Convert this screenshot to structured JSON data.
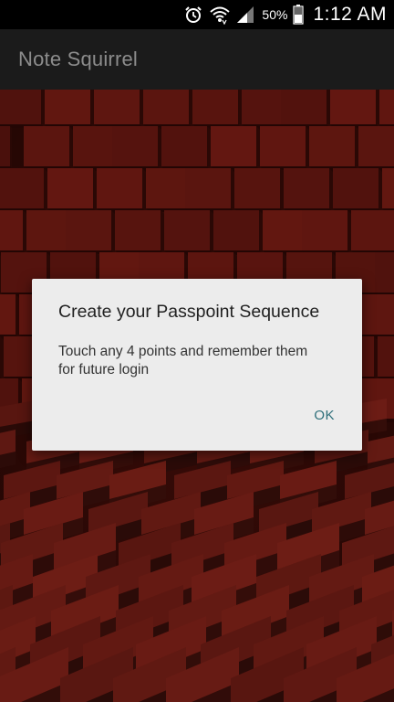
{
  "status_bar": {
    "icons": [
      "alarm-clock-icon",
      "wifi-icon",
      "cell-signal-icon",
      "battery-icon"
    ],
    "battery_percent": "50%",
    "time": "1:12 AM"
  },
  "action_bar": {
    "title": "Note Squirrel"
  },
  "dialog": {
    "title": "Create your Passpoint Sequence",
    "message_line1": "Touch any 4 points and remember them",
    "message_line2": "for future login",
    "ok_label": "OK"
  },
  "colors": {
    "action_bar_bg": "#1b1b1b",
    "title_text": "#8c8c8c",
    "dialog_bg": "#ececec",
    "ok_button": "#2e6f7a",
    "background_cubes": "#4a100b"
  }
}
